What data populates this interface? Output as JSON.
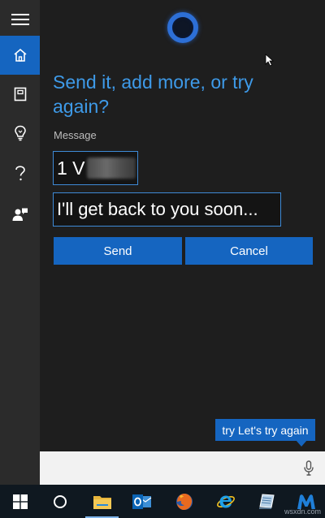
{
  "rail": {
    "items": [
      {
        "icon": "hamburger-menu-icon",
        "active": false
      },
      {
        "icon": "home-icon",
        "active": true
      },
      {
        "icon": "notebook-icon",
        "active": false
      },
      {
        "icon": "lightbulb-icon",
        "active": false
      },
      {
        "icon": "help-icon",
        "active": false
      },
      {
        "icon": "feedback-icon",
        "active": false
      }
    ]
  },
  "cortana": {
    "headline": "Send it, add more, or try again?",
    "message_label": "Message",
    "recipient_visible": "1 V",
    "message_text": "I'll get back to you soon...",
    "send_label": "Send",
    "cancel_label": "Cancel",
    "bubble_text": "try Let's try again"
  },
  "taskbar": {
    "items": [
      "windows-start-icon",
      "cortana-search-icon",
      "file-explorer-icon",
      "outlook-icon",
      "firefox-icon",
      "internet-explorer-icon",
      "app-icon",
      "malwarebytes-icon"
    ],
    "watermark": "wsxdn.com"
  },
  "colors": {
    "accent": "#1565c0",
    "headline": "#3e9ae8",
    "background": "#1e1e1e",
    "rail": "#2b2b2b",
    "taskbar": "#0f1820"
  }
}
